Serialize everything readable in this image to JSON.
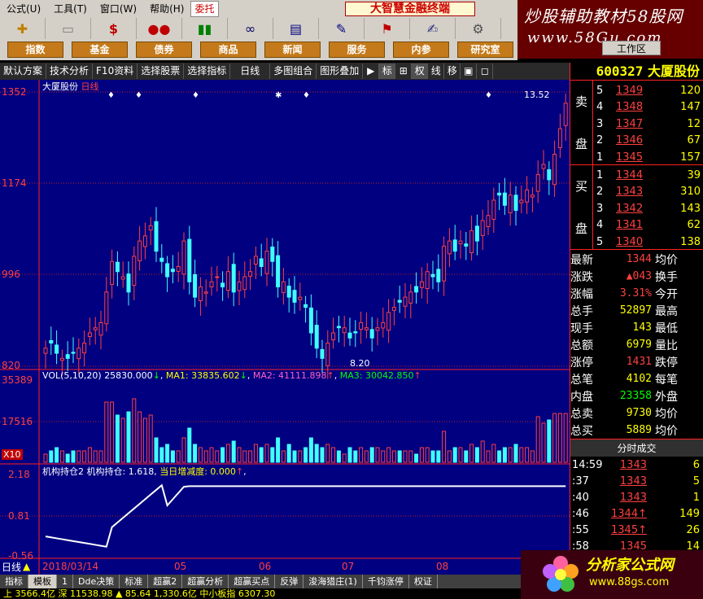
{
  "menu": [
    "公式(U)",
    "工具(T)",
    "窗口(W)",
    "帮助(H)"
  ],
  "menu_active": "委托",
  "app_title": "大智慧金融终端",
  "watermark_top": {
    "line1": "炒股辅助教材58股网",
    "line2": "www.58Gu.com"
  },
  "categories": [
    "指数",
    "基金",
    "债券",
    "商品",
    "新闻",
    "服务",
    "内参",
    "研究室"
  ],
  "workarea": "工作区",
  "chart_toolbar": [
    "默认方案",
    "技术分析",
    "F10资料",
    "选择股票",
    "选择指标",
    "日线",
    "多图组合",
    "图形叠加"
  ],
  "chart_toolbar_icons": [
    "标",
    "权",
    "线",
    "移"
  ],
  "chart": {
    "stock_label": "大厦股份",
    "period_label": "日线",
    "y_labels": [
      "1352",
      "1174",
      "996",
      "820"
    ],
    "high_annot": "13.52",
    "low_annot": "8.20",
    "vol_header": {
      "title": "VOL(5,10,20)",
      "vol": "25830.000",
      "ma1": "MA1: 33835.602",
      "ma2": "MA2: 41111.898",
      "ma3": "MA3: 30042.850"
    },
    "vol_y": [
      "35389",
      "17516",
      "X10"
    ],
    "ind_header": {
      "title": "机构持仓2",
      "val1": "机构持仓: 1.618,",
      "val2": "当日增减度: 0.000"
    },
    "ind_y": [
      "2.18",
      "0.81",
      "-0.56"
    ],
    "x_labels": [
      "2018/03/14",
      "05",
      "06",
      "07",
      "08"
    ],
    "period_bottom": "日线"
  },
  "chart_data": {
    "type": "candlestick",
    "price_range": [
      8.2,
      13.52
    ],
    "closes": [
      8.5,
      8.6,
      8.4,
      8.3,
      8.3,
      8.4,
      8.5,
      8.6,
      8.8,
      8.9,
      9.0,
      9.6,
      10.2,
      10.0,
      9.9,
      9.6,
      10.3,
      10.6,
      10.7,
      10.9,
      10.4,
      10.2,
      9.9,
      10.0,
      10.1,
      10.6,
      9.8,
      9.5,
      9.7,
      9.6,
      9.8,
      9.9,
      9.7,
      10.0,
      9.6,
      9.8,
      9.9,
      10.0,
      10.3,
      10.1,
      10.4,
      10.2,
      9.7,
      9.8,
      9.5,
      9.4,
      9.5,
      9.3,
      8.8,
      8.5,
      8.3,
      8.6,
      8.8,
      8.9,
      8.9,
      8.7,
      8.8,
      9.0,
      8.9,
      8.7,
      8.9,
      9.0,
      9.2,
      9.3,
      9.4,
      9.5,
      9.6,
      9.6,
      9.8,
      10.0,
      9.9,
      9.8,
      10.5,
      10.6,
      10.4,
      10.6,
      10.5,
      10.8,
      10.6,
      11.0,
      11.1,
      11.4,
      11.5,
      11.3,
      11.5,
      11.2,
      11.4,
      11.6,
      11.5,
      11.9,
      12.1,
      11.8,
      12.3,
      12.8,
      13.3
    ]
  },
  "orderbook": {
    "sell_label": [
      "卖",
      "盘"
    ],
    "buy_label": [
      "买",
      "盘"
    ],
    "sell": [
      {
        "lv": "5",
        "p": "1349",
        "v": "120"
      },
      {
        "lv": "4",
        "p": "1348",
        "v": "147"
      },
      {
        "lv": "3",
        "p": "1347",
        "v": "12"
      },
      {
        "lv": "2",
        "p": "1346",
        "v": "67"
      },
      {
        "lv": "1",
        "p": "1345",
        "v": "157"
      }
    ],
    "buy": [
      {
        "lv": "1",
        "p": "1344",
        "v": "39"
      },
      {
        "lv": "2",
        "p": "1343",
        "v": "310"
      },
      {
        "lv": "3",
        "p": "1342",
        "v": "143"
      },
      {
        "lv": "4",
        "p": "1341",
        "v": "62"
      },
      {
        "lv": "5",
        "p": "1340",
        "v": "138"
      }
    ]
  },
  "stock": {
    "code": "600327",
    "name": "大厦股份"
  },
  "stats": [
    {
      "l": "最新",
      "v": "1344",
      "r": "均价",
      "c": "red"
    },
    {
      "l": "涨跌",
      "v": "▲043",
      "r": "换手",
      "c": "red"
    },
    {
      "l": "涨幅",
      "v": "3.31%",
      "r": "今开",
      "c": "red"
    },
    {
      "l": "总手",
      "v": "52897",
      "r": "最高",
      "c": "yel"
    },
    {
      "l": "现手",
      "v": "143",
      "r": "最低",
      "c": "yel"
    },
    {
      "l": "总额",
      "v": "6979",
      "r": "量比",
      "c": "yel"
    },
    {
      "l": "涨停",
      "v": "1431",
      "r": "跌停",
      "c": "red"
    },
    {
      "l": "总笔",
      "v": "4102",
      "r": "每笔",
      "c": "yel"
    },
    {
      "l": "内盘",
      "v": "23358",
      "r": "外盘",
      "c": "grn"
    },
    {
      "l": "总卖",
      "v": "9730",
      "r": "均价",
      "c": "yel"
    },
    {
      "l": "总买",
      "v": "5889",
      "r": "均价",
      "c": "yel"
    }
  ],
  "ts_title": "分时成交",
  "ticks": [
    {
      "t": "14:59",
      "p": "1343",
      "v": "6"
    },
    {
      "t": ":37",
      "p": "1343",
      "v": "5"
    },
    {
      "t": ":40",
      "p": "1343",
      "v": "1"
    },
    {
      "t": ":46",
      "p": "1344↑",
      "v": "149"
    },
    {
      "t": ":55",
      "p": "1345↑",
      "v": "26"
    },
    {
      "t": ":58",
      "p": "1345",
      "v": "14"
    }
  ],
  "watermark_bottom": {
    "line1": "分析家公式网",
    "line2": "www.88gs.com"
  },
  "tabs": [
    "指标",
    "模板",
    "1",
    "Dde决策",
    "标准",
    "超赢2",
    "超赢分析",
    "超赢买点",
    "反弹",
    "浚海猎庄(1)",
    "千钧涨停",
    "权证"
  ],
  "statusbar": "上 3566.4亿 深 11538.98 ▲ 85.64 1,330.6亿 中小板指 6307.30"
}
